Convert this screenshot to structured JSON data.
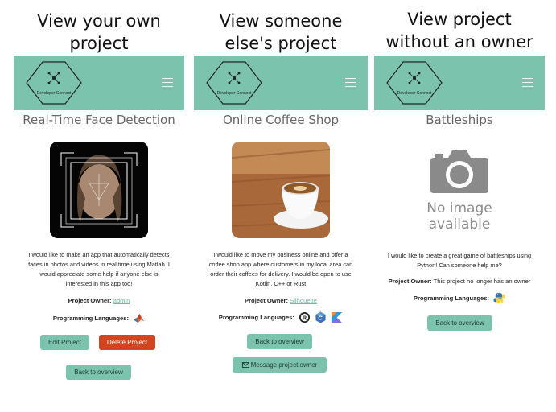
{
  "headings": {
    "own": [
      "View your own",
      "project"
    ],
    "other": [
      "View someone",
      "else's project"
    ],
    "noowner": [
      "View project",
      "without an owner"
    ]
  },
  "brand": {
    "logo_text": "Developer Connect"
  },
  "panels": {
    "own": {
      "title": "Real-Time Face Detection",
      "description": [
        "I would like to make an app that automatically detects",
        "faces in photos and videos in real time using Matlab. I",
        "would appreciate some help if anyone else is",
        "interested in this app too!"
      ],
      "owner_label": "Project Owner:",
      "owner_value": "admin",
      "languages_label": "Programming Languages:",
      "edit_label": "Edit Project",
      "delete_label": "Delete Project",
      "back_label": "Back to overview"
    },
    "other": {
      "title": "Online Coffee Shop",
      "description": [
        "I would like to move my business online and offer a",
        "coffee shop app where customers in my local area can",
        "order their coffees for delivery. I would be open to use",
        "Kotlin, C++ or Rust"
      ],
      "owner_label": "Project Owner:",
      "owner_value": "Silhouette",
      "languages_label": "Programming Languages:",
      "back_label": "Back to overview",
      "message_label": "Message project owner"
    },
    "noowner": {
      "title": "Battleships",
      "no_image_text": [
        "No image",
        "available"
      ],
      "description": [
        "I would like to create a great game of battleships using",
        "Python! Can someone help me?"
      ],
      "owner_label": "Project Owner:",
      "owner_value": "This project no longer has an owner",
      "languages_label": "Programming Languages:",
      "back_label": "Back to overview"
    }
  },
  "icons": {
    "menu": "hamburger-menu-icon",
    "matlab": "matlab-icon",
    "rust": "rust-icon",
    "cpp": "cpp-icon",
    "kotlin": "kotlin-icon",
    "python": "python-icon",
    "envelope": "envelope-icon",
    "camera": "camera-icon"
  },
  "colors": {
    "navbar": "#7cc3ad",
    "button_green": "#7cc3ad",
    "button_red": "#d2451f",
    "link": "#6bbba3"
  }
}
